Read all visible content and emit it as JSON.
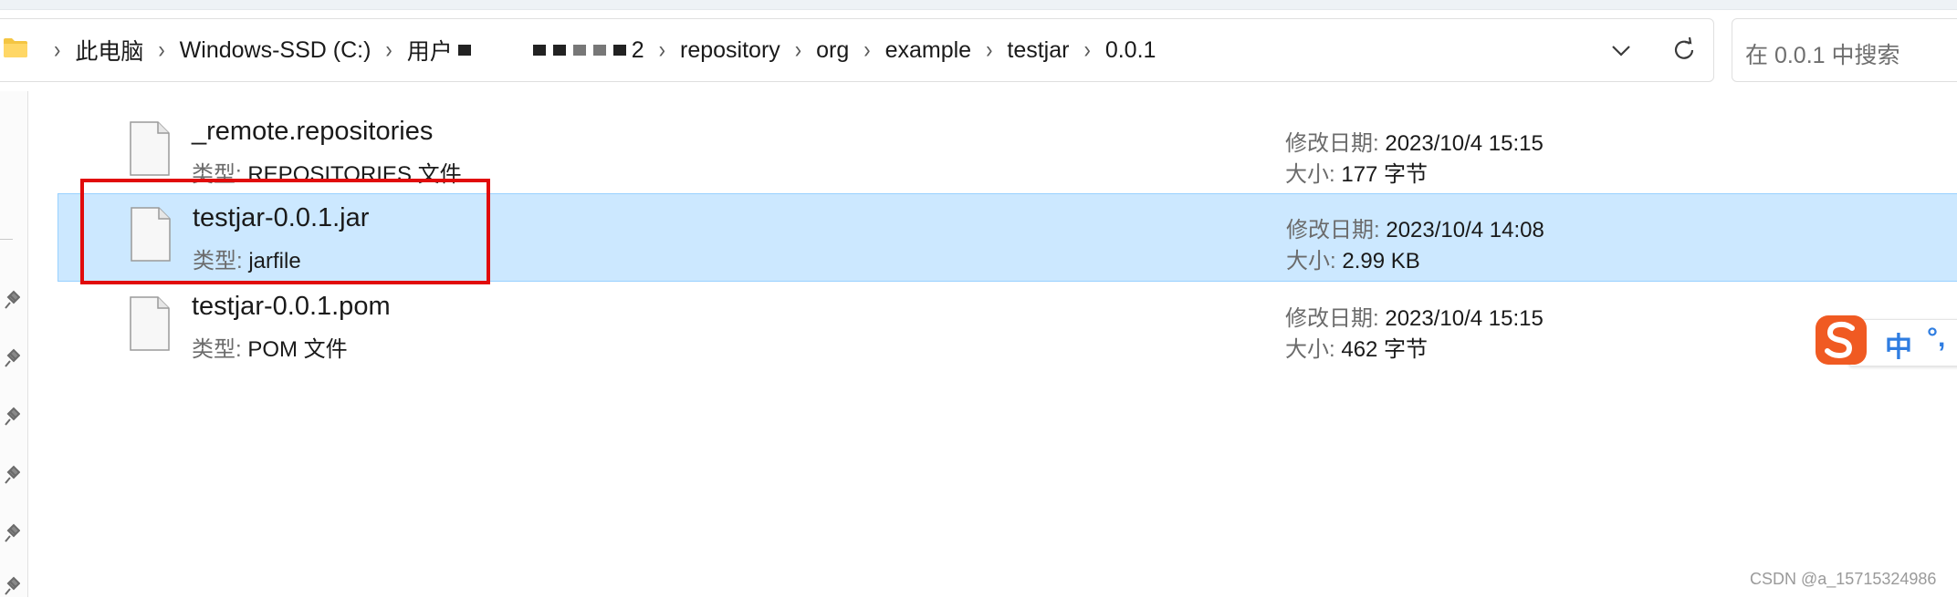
{
  "address": {
    "breadcrumbs": [
      "此电脑",
      "Windows-SSD (C:)",
      "用户",
      "2",
      "repository",
      "org",
      "example",
      "testjar",
      "0.0.1"
    ]
  },
  "search": {
    "placeholder": "在 0.0.1 中搜索"
  },
  "files": [
    {
      "name": "_remote.repositories",
      "type_label": "类型:",
      "type": "REPOSITORIES 文件",
      "date_label": "修改日期:",
      "date": "2023/10/4 15:15",
      "size_label": "大小:",
      "size": "177 字节",
      "selected": false
    },
    {
      "name": "testjar-0.0.1.jar",
      "type_label": "类型:",
      "type": "jarfile",
      "date_label": "修改日期:",
      "date": "2023/10/4 14:08",
      "size_label": "大小:",
      "size": "2.99 KB",
      "selected": true
    },
    {
      "name": "testjar-0.0.1.pom",
      "type_label": "类型:",
      "type": "POM 文件",
      "date_label": "修改日期:",
      "date": "2023/10/4 15:15",
      "size_label": "大小:",
      "size": "462 字节",
      "selected": false
    }
  ],
  "ime": {
    "mode": "中",
    "punctuation": "°,"
  },
  "watermark": "CSDN @a_15715324986",
  "colors": {
    "selection": "#cce8ff",
    "highlight": "#e10b0b",
    "folder": "#f4c542",
    "ime_logo": "#f05a22",
    "ime_text": "#2f7de1"
  },
  "icons": [
    "folder-icon",
    "chevron-right-icon",
    "chevron-down-icon",
    "refresh-icon",
    "pin-icon",
    "file-icon",
    "sogou-ime-icon"
  ]
}
